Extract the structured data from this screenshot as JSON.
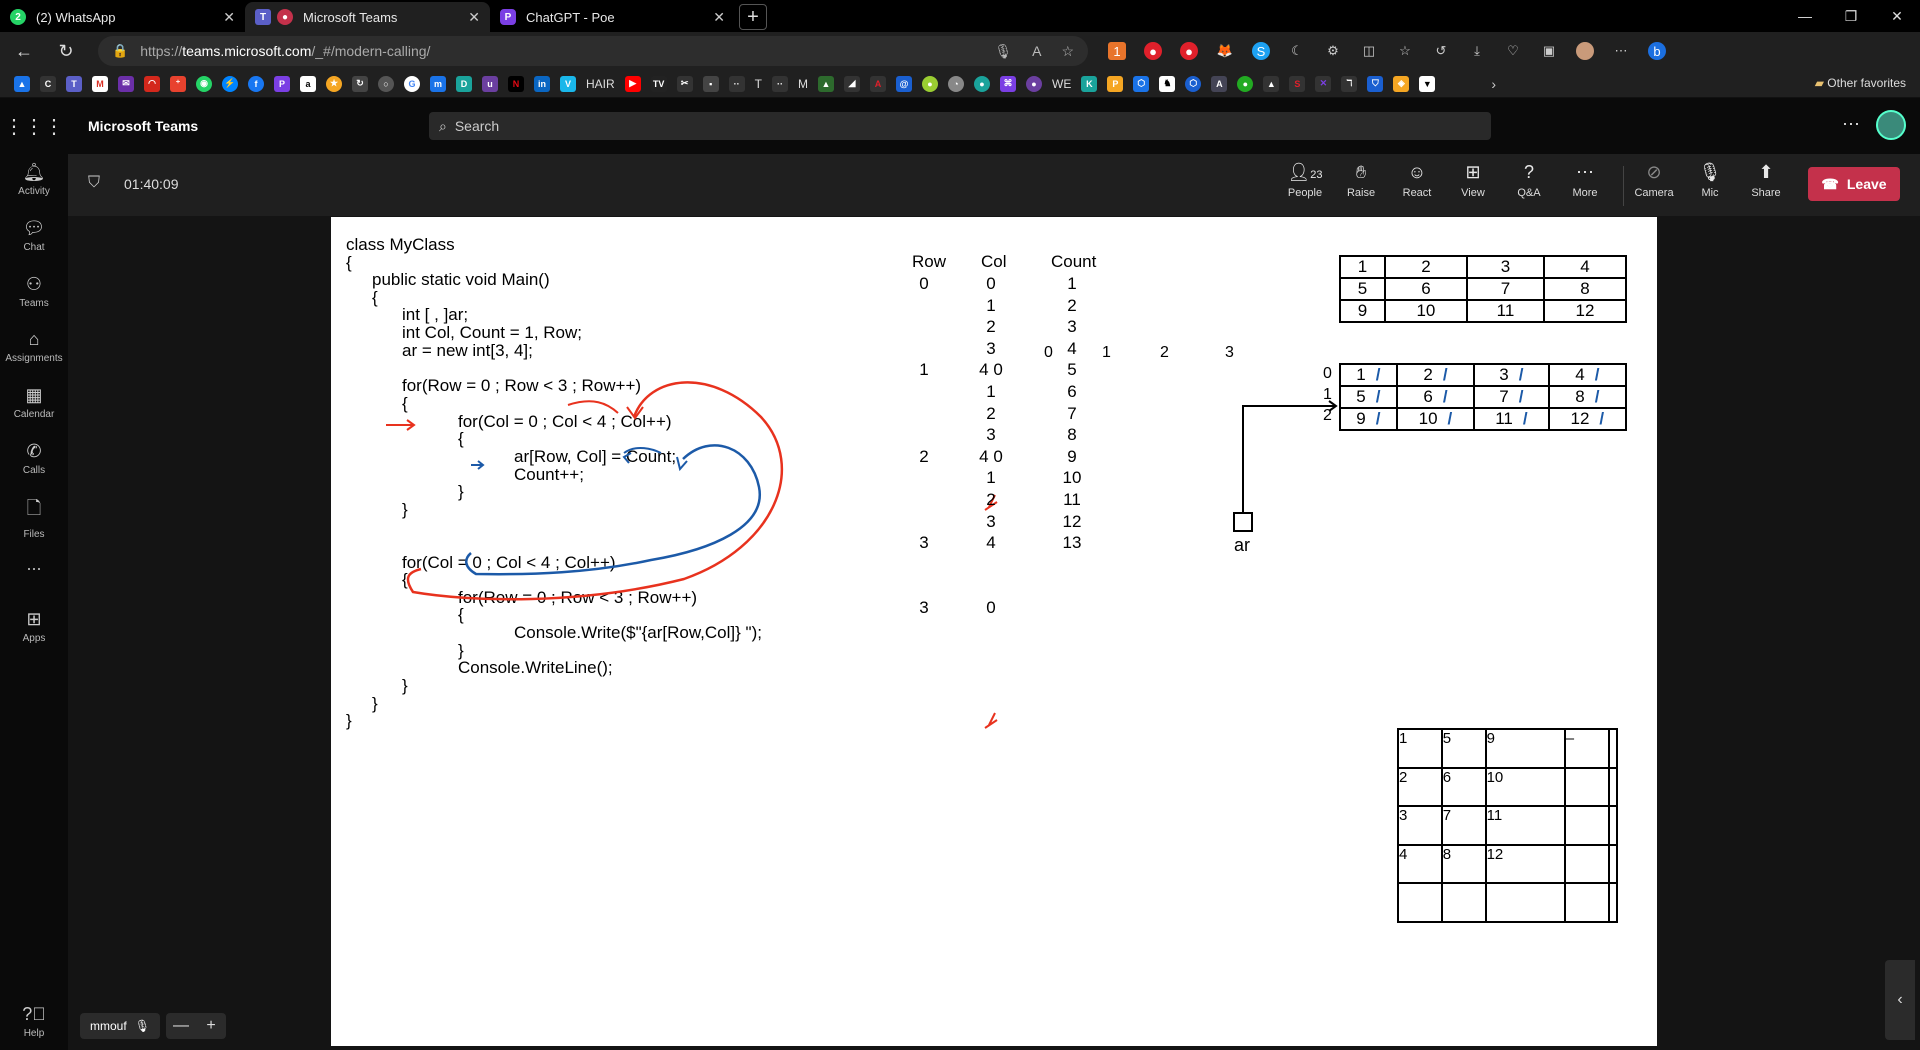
{
  "browser": {
    "tabs": [
      {
        "title": "(2) WhatsApp",
        "fav_color": "#25d366",
        "fav_text": "2"
      },
      {
        "title": "Microsoft Teams",
        "fav_color": "#c4314b",
        "fav_text": "●"
      },
      {
        "title": "ChatGPT - Poe",
        "fav_color": "#7b3fe4",
        "fav_text": "P"
      }
    ],
    "url_prefix": "https://",
    "url_host": "teams.microsoft.com",
    "url_path": "/_#/modern-calling/",
    "bookmarks": {
      "hair_label": "HAIR",
      "t_label": "T",
      "m_label": "M",
      "we_label": "WE",
      "other_favorites": "Other favorites"
    }
  },
  "teams": {
    "app_title": "Microsoft Teams",
    "search_placeholder": "Search",
    "rail": [
      {
        "label": "Activity",
        "icon": "bell-icon"
      },
      {
        "label": "Chat",
        "icon": "chat-icon"
      },
      {
        "label": "Teams",
        "icon": "teams-icon"
      },
      {
        "label": "Assignments",
        "icon": "assignments-icon"
      },
      {
        "label": "Calendar",
        "icon": "calendar-icon"
      },
      {
        "label": "Calls",
        "icon": "phone-icon"
      },
      {
        "label": "Files",
        "icon": "file-icon"
      },
      {
        "label": "...",
        "icon": "more-icon"
      },
      {
        "label": "Apps",
        "icon": "apps-icon"
      },
      {
        "label": "Help",
        "icon": "help-icon"
      }
    ],
    "meeting": {
      "timer": "01:40:09",
      "people_count": "23",
      "tools": {
        "people": "People",
        "raise": "Raise",
        "react": "React",
        "view": "View",
        "qa": "Q&A",
        "more": "More",
        "camera": "Camera",
        "mic": "Mic",
        "share": "Share"
      },
      "leave": "Leave"
    },
    "participant_name": "mmouf"
  },
  "whiteboard": {
    "code_lines": [
      "class MyClass",
      "{",
      "public static void Main()",
      "{",
      "int [ , ]ar;",
      "int Col, Count = 1, Row;",
      "ar = new int[3, 4];",
      "for(Row = 0 ; Row < 3 ; Row++)",
      "{",
      "for(Col = 0 ; Col < 4 ; Col++)",
      "{",
      "ar[Row, Col] = Count;",
      "Count++;",
      "}",
      "}",
      "for(Col = 0 ; Col < 4 ; Col++)",
      "{",
      "for(Row = 0 ; Row < 3 ; Row++)",
      "{",
      "Console.Write($\"{ar[Row,Col]} \");",
      "}",
      "Console.WriteLine();",
      "}",
      "}",
      "}"
    ],
    "trace": {
      "headers": [
        "Row",
        "Col",
        "Count"
      ],
      "row_values": [
        "0",
        "",
        "",
        "",
        "1",
        "",
        "",
        "",
        "2",
        "",
        "",
        "",
        "3",
        "",
        "",
        "3"
      ],
      "col_values": [
        "0",
        "1",
        "2",
        "3",
        "4 0",
        "1",
        "2",
        "3",
        "4 0",
        "1",
        "2",
        "3",
        "4",
        "",
        "",
        "0"
      ],
      "count_values": [
        "1",
        "2",
        "3",
        "4",
        "5",
        "6",
        "7",
        "8",
        "9",
        "10",
        "11",
        "12",
        "13",
        "",
        "",
        ""
      ]
    },
    "array_top": [
      [
        "1",
        "2",
        "3",
        "4"
      ],
      [
        "5",
        "6",
        "7",
        "8"
      ],
      [
        "9",
        "10",
        "11",
        "12"
      ]
    ],
    "array_mid": {
      "col_index": [
        "0",
        "1",
        "2",
        "3"
      ],
      "row_index": [
        "0",
        "1",
        "2"
      ],
      "cells": [
        [
          "1",
          "2",
          "3",
          "4"
        ],
        [
          "5",
          "6",
          "7",
          "8"
        ],
        [
          "9",
          "10",
          "11",
          "12"
        ]
      ],
      "var_label": "ar"
    },
    "array_bottom": [
      [
        "1",
        "5",
        "9",
        "–",
        ""
      ],
      [
        "2",
        "6",
        "10",
        "",
        ""
      ],
      [
        "3",
        "7",
        "11",
        "",
        ""
      ],
      [
        "4",
        "8",
        "12",
        "",
        ""
      ],
      [
        "",
        "",
        "",
        "",
        ""
      ]
    ]
  }
}
